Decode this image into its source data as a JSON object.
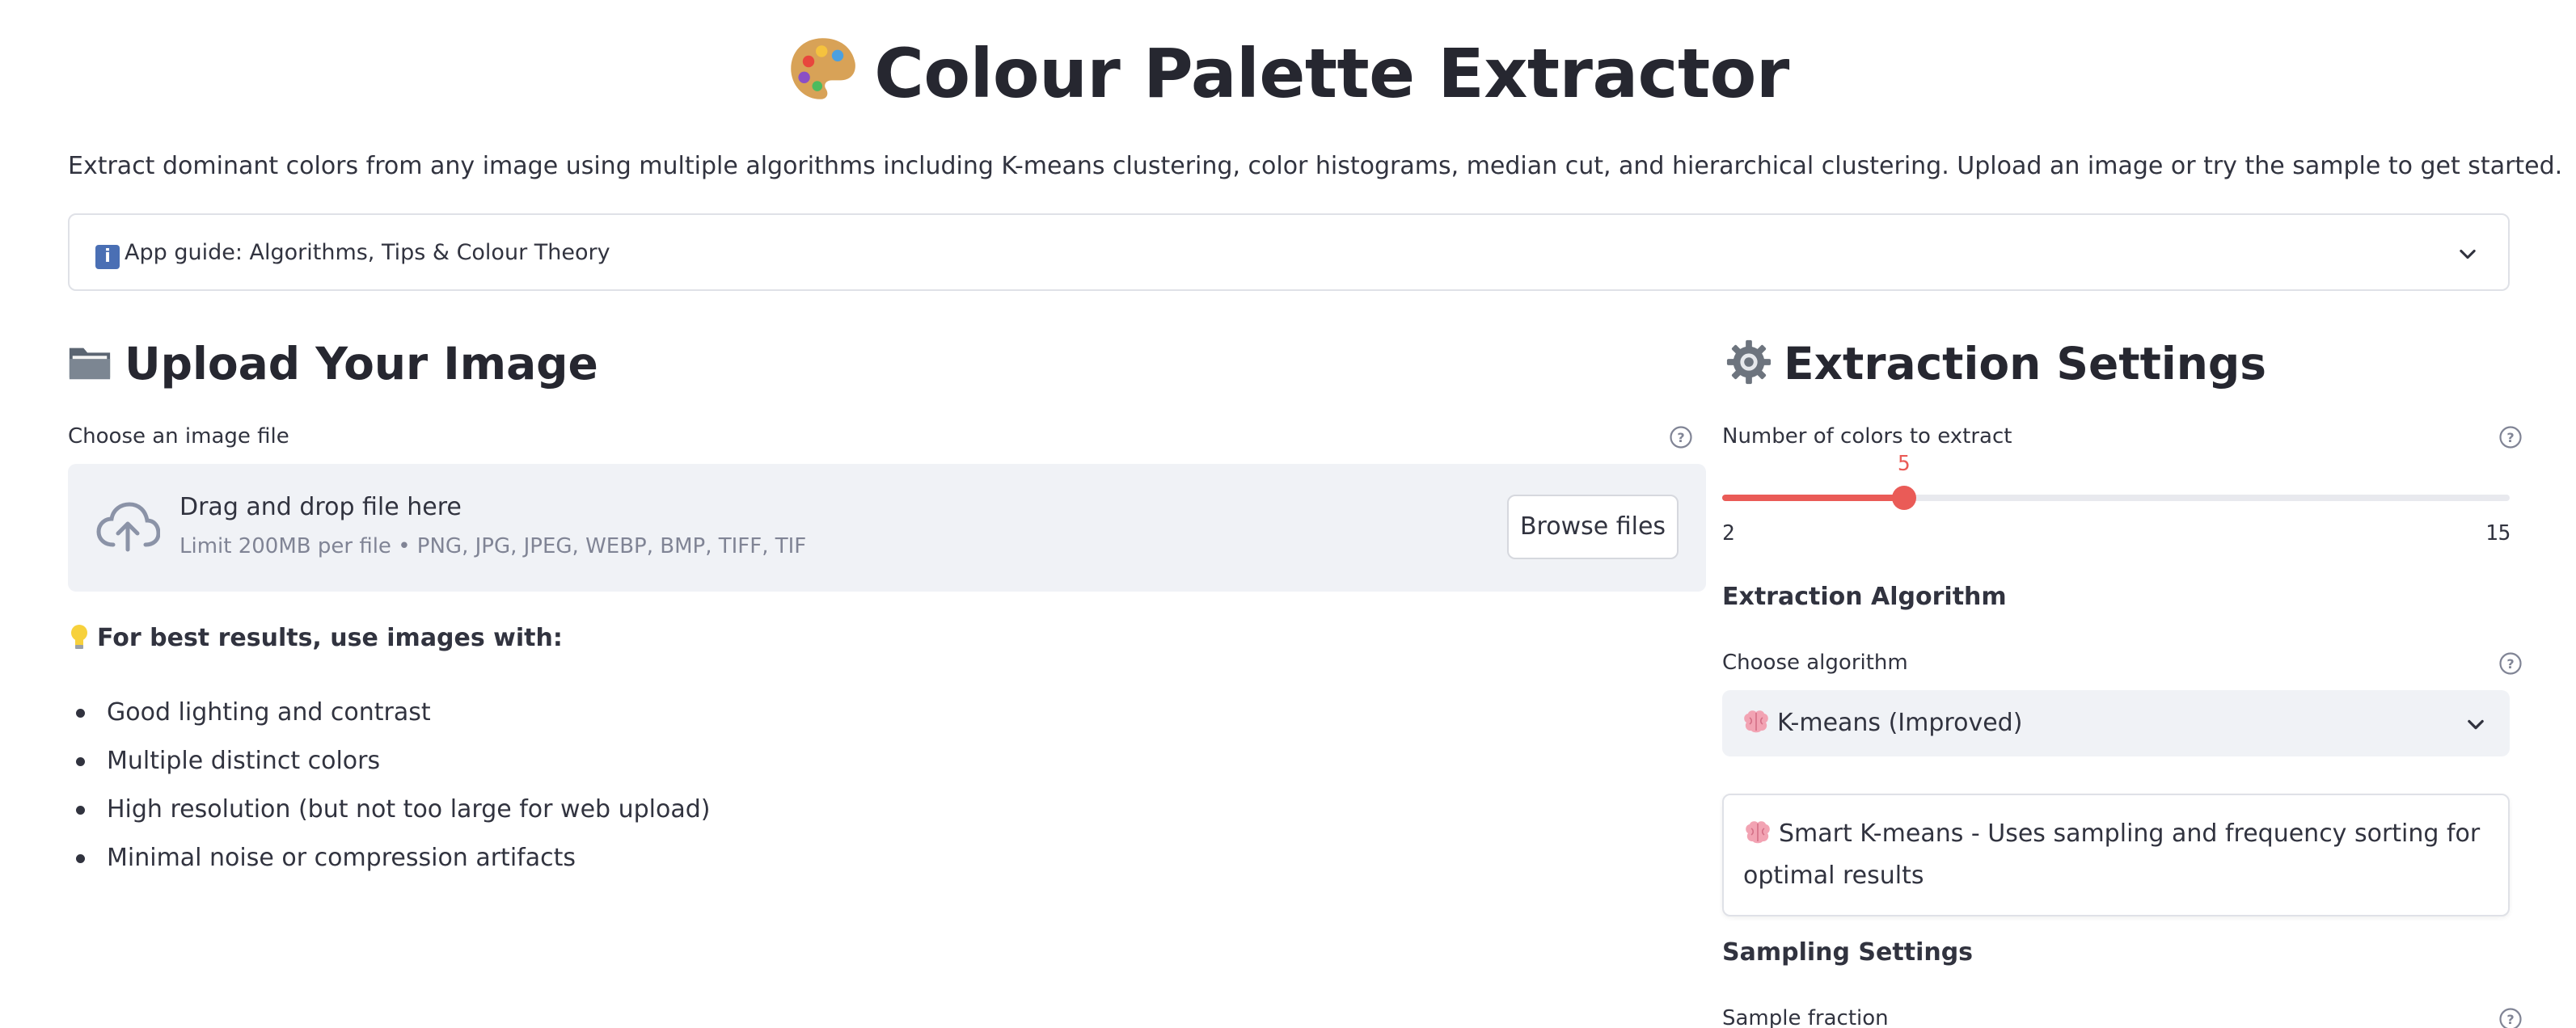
{
  "header": {
    "title": "Colour Palette Extractor",
    "title_icon": "palette-icon",
    "intro": "Extract dominant colors from any image using multiple algorithms including K-means clustering, color histograms, median cut, and hierarchical clustering. Upload an image or try the sample to get started."
  },
  "guide": {
    "label": "App guide: Algorithms, Tips & Colour Theory",
    "icon": "info-icon",
    "expanded": false
  },
  "upload": {
    "heading": "Upload Your Image",
    "heading_icon": "folder-icon",
    "field_label": "Choose an image file",
    "dropzone_title": "Drag and drop file here",
    "dropzone_limit": "Limit 200MB per file • PNG, JPG, JPEG, WEBP, BMP, TIFF, TIF",
    "browse_label": "Browse files"
  },
  "tips": {
    "heading": "For best results, use images with:",
    "items": [
      "Good lighting and contrast",
      "Multiple distinct colors",
      "High resolution (but not too large for web upload)",
      "Minimal noise or compression artifacts"
    ]
  },
  "settings": {
    "heading": "Extraction Settings",
    "heading_icon": "gear-icon",
    "num_colors": {
      "label": "Number of colors to extract",
      "value": "5",
      "value_num": 5,
      "min": "2",
      "max": "15",
      "min_num": 2,
      "max_num": 15
    },
    "algorithm_heading": "Extraction Algorithm",
    "algorithm_label": "Choose algorithm",
    "algorithm_value": "K-means (Improved)",
    "algorithm_info": "Smart K-means - Uses sampling and frequency sorting for optimal results",
    "sampling_heading": "Sampling Settings",
    "sample_fraction_label": "Sample fraction"
  },
  "colors": {
    "accent": "#ea5b57",
    "text": "#31333f",
    "muted": "#808495",
    "surface": "#f0f2f6",
    "border": "#dfe1e7"
  }
}
